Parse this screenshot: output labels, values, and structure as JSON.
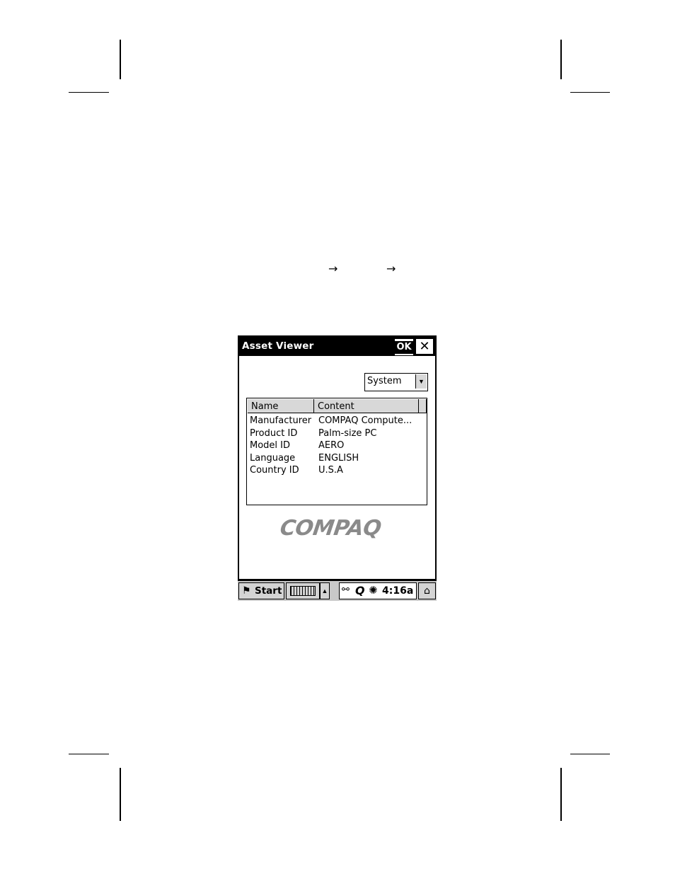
{
  "page": {
    "arrows": [
      "→",
      "→"
    ]
  },
  "window": {
    "title": "Asset Viewer",
    "ok_label": "OK",
    "close_label": "✕"
  },
  "category_select": {
    "selected": "System",
    "options": [
      "System"
    ]
  },
  "listview": {
    "columns": [
      "Name",
      "Content"
    ],
    "rows": [
      {
        "name": "Manufacturer",
        "content": "COMPAQ Compute..."
      },
      {
        "name": "Product ID",
        "content": "Palm-size PC"
      },
      {
        "name": "Model ID",
        "content": "AERO"
      },
      {
        "name": "Language",
        "content": "ENGLISH"
      },
      {
        "name": "Country ID",
        "content": "U.S.A"
      }
    ]
  },
  "logo_text": "COMPAQ",
  "taskbar": {
    "start_label": "Start",
    "clock": "4:16a",
    "icons": [
      "start-flag-icon",
      "keyboard-icon",
      "chevron-up-icon",
      "connection-icon",
      "compaq-q-icon",
      "backlight-icon",
      "desktop-icon"
    ]
  }
}
